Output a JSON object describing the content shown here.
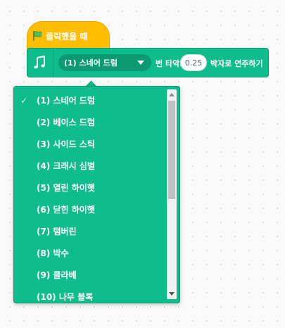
{
  "hat_block": {
    "label": "클릭했을 때",
    "icon": "green-flag-icon"
  },
  "music_block": {
    "icon": "music-notes-icon",
    "drum_selected": "(1) 스네어 드럼",
    "text_after_drum": "번 타악기를",
    "beats_value": "0.25",
    "text_after_beats": "박자로 연주하기"
  },
  "dropdown": {
    "selected_mark": "✓",
    "items": [
      {
        "label": "(1) 스네어 드럼"
      },
      {
        "label": "(2) 베이스 드럼"
      },
      {
        "label": "(3) 사이드 스틱"
      },
      {
        "label": "(4) 크래시 심벌"
      },
      {
        "label": "(5) 열린 하이햇"
      },
      {
        "label": "(6) 닫힌 하이햇"
      },
      {
        "label": "(7) 탬버린"
      },
      {
        "label": "(8) 박수"
      },
      {
        "label": "(9) 클라베"
      },
      {
        "label": "(10) 나무 블록"
      }
    ]
  },
  "colors": {
    "music_green": "#0fbd8c",
    "music_green_dark": "#0b9a72",
    "events_yellow": "#ffbf00",
    "flag_green": "#4cbf56"
  }
}
